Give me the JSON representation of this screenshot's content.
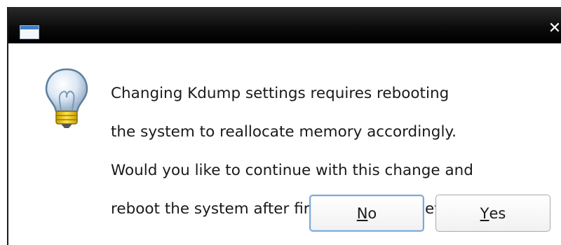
{
  "window": {
    "title_icon": "window-icon",
    "close_icon": "close-icon",
    "close_glyph": "✕"
  },
  "message": {
    "icon": "lightbulb-icon",
    "lines": [
      "Changing Kdump settings requires rebooting",
      "the system to reallocate memory accordingly.",
      "Would you like to continue with this change and",
      "reboot the system after firstboot is complete?"
    ]
  },
  "buttons": {
    "no": {
      "mnemonic": "N",
      "rest": "o"
    },
    "yes": {
      "mnemonic": "Y",
      "rest": "es"
    }
  },
  "colors": {
    "titlebar": "#000000",
    "focus_border": "#7ca9d8"
  }
}
